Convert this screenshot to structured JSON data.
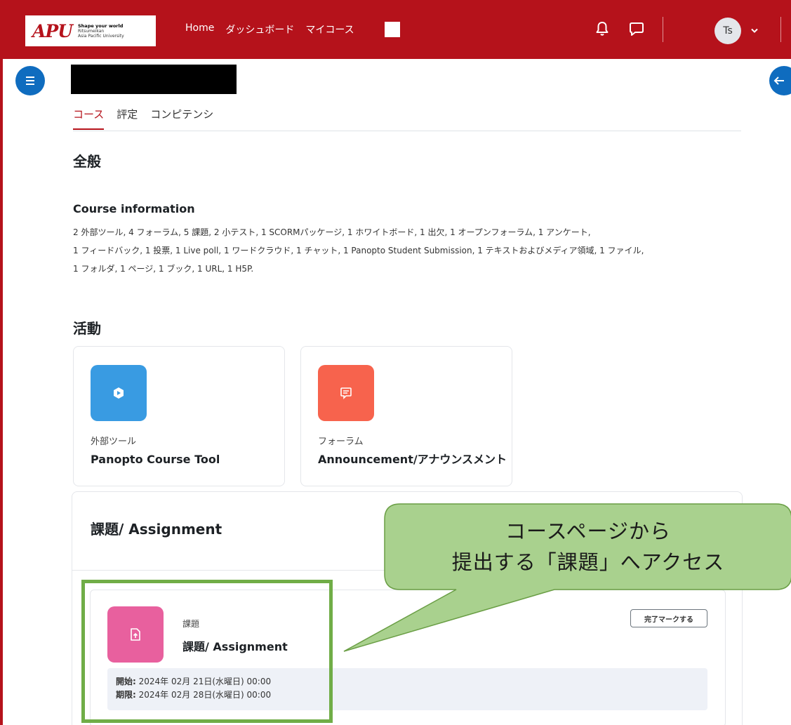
{
  "header": {
    "logo_mark": "APU",
    "logo_tagline": "Shape your world",
    "logo_line1": "Ritsumeikan",
    "logo_line2": "Asia Pacific University",
    "nav": [
      "Home",
      "ダッシュボード",
      "マイコース"
    ],
    "avatar_initials": "Ts",
    "icons": [
      "bell-icon",
      "chat-icon",
      "chevron-down-icon"
    ]
  },
  "tabs": [
    "コース",
    "評定",
    "コンピテンシ"
  ],
  "general": {
    "heading": "全般",
    "course_info_title": "Course information",
    "course_info_lines": [
      "2 外部ツール, 4 フォーラム, 5 課題, 2 小テスト, 1 SCORMパッケージ, 1 ホワイトボード, 1 出欠, 1 オープンフォーラム, 1 アンケート,",
      "1 フィードバック, 1 投票, 1 Live poll, 1 ワードクラウド, 1 チャット, 1 Panopto Student Submission, 1 テキストおよびメディア領域, 1 ファイル,",
      "1 フォルダ, 1 ページ, 1 ブック, 1 URL, 1 H5P."
    ]
  },
  "activities": {
    "heading": "活動",
    "cards": [
      {
        "type": "外部ツール",
        "name": "Panopto Course Tool",
        "icon": "play-icon",
        "color": "#399be2"
      },
      {
        "type": "フォーラム",
        "name": "Announcement/アナウンスメント",
        "icon": "forum-icon",
        "color": "#f7634d"
      }
    ]
  },
  "assignment_section": {
    "title": "課題/ Assignment",
    "item": {
      "type": "課題",
      "name": "課題/ Assignment",
      "icon": "assignment-upload-icon",
      "color": "#e8609e",
      "mark_button": "完了マークする",
      "start_label": "開始:",
      "start_value": "2024年 02月 21日(水曜日) 00:00",
      "due_label": "期限:",
      "due_value": "2024年 02月 28日(水曜日) 00:00"
    }
  },
  "callout": {
    "line1": "コースページから",
    "line2": "提出する「課題」へアクセス"
  },
  "colors": {
    "brand": "#b5121b",
    "primary": "#0f6cbf",
    "highlight": "#70ad47",
    "callout_fill": "#a9d18e"
  }
}
